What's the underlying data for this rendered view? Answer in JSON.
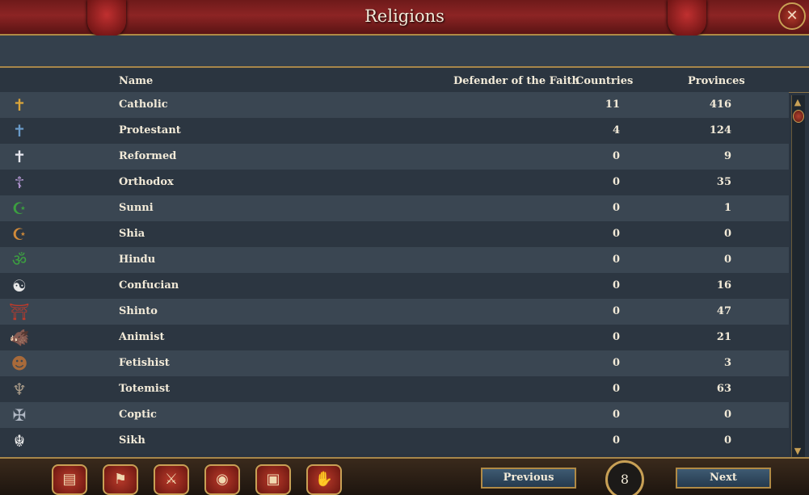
{
  "window": {
    "title": "Religions",
    "close_icon": "close-icon"
  },
  "columns": {
    "name": "Name",
    "defender": "Defender of the Faith",
    "countries": "Countries",
    "provinces": "Provinces"
  },
  "religions": [
    {
      "icon": "cross-icon",
      "glyph": "✝",
      "color": "#d9a53a",
      "name": "Catholic",
      "countries": "11",
      "provinces": "416"
    },
    {
      "icon": "cross-icon",
      "glyph": "✝",
      "color": "#6a9ac8",
      "name": "Protestant",
      "countries": "4",
      "provinces": "124"
    },
    {
      "icon": "cross-icon",
      "glyph": "✝",
      "color": "#e8e8f0",
      "name": "Reformed",
      "countries": "0",
      "provinces": "9"
    },
    {
      "icon": "orthodox-cross-icon",
      "glyph": "☦",
      "color": "#b89ad8",
      "name": "Orthodox",
      "countries": "0",
      "provinces": "35"
    },
    {
      "icon": "crescent-icon",
      "glyph": "☪",
      "color": "#3ca040",
      "name": "Sunni",
      "countries": "0",
      "provinces": "1"
    },
    {
      "icon": "crescent-icon",
      "glyph": "☪",
      "color": "#d08a3a",
      "name": "Shia",
      "countries": "0",
      "provinces": "0"
    },
    {
      "icon": "om-icon",
      "glyph": "ॐ",
      "color": "#3ca040",
      "name": "Hindu",
      "countries": "0",
      "provinces": "0"
    },
    {
      "icon": "yin-yang-icon",
      "glyph": "☯",
      "color": "#e8e8e8",
      "name": "Confucian",
      "countries": "0",
      "provinces": "16"
    },
    {
      "icon": "torii-gate-icon",
      "glyph": "⛩",
      "color": "#c03a2a",
      "name": "Shinto",
      "countries": "0",
      "provinces": "47"
    },
    {
      "icon": "animal-icon",
      "glyph": "🐗",
      "color": "#c04a2a",
      "name": "Animist",
      "countries": "0",
      "provinces": "21"
    },
    {
      "icon": "mask-icon",
      "glyph": "☻",
      "color": "#a86a3a",
      "name": "Fetishist",
      "countries": "0",
      "provinces": "3"
    },
    {
      "icon": "totem-icon",
      "glyph": "♆",
      "color": "#a89a88",
      "name": "Totemist",
      "countries": "0",
      "provinces": "63"
    },
    {
      "icon": "coptic-cross-icon",
      "glyph": "✠",
      "color": "#b0b8c4",
      "name": "Coptic",
      "countries": "0",
      "provinces": "0"
    },
    {
      "icon": "khanda-icon",
      "glyph": "☬",
      "color": "#e8e8e8",
      "name": "Sikh",
      "countries": "0",
      "provinces": "0"
    }
  ],
  "bottom_buttons": [
    {
      "icon": "scroll-icon",
      "glyph": "▤"
    },
    {
      "icon": "flag-icon",
      "glyph": "⚑"
    },
    {
      "icon": "crossed-swords-icon",
      "glyph": "⚔"
    },
    {
      "icon": "coins-icon",
      "glyph": "◉"
    },
    {
      "icon": "crate-icon",
      "glyph": "▣"
    },
    {
      "icon": "handshake-icon",
      "glyph": "✋"
    }
  ],
  "pagination": {
    "previous": "Previous",
    "page": "8",
    "next": "Next"
  }
}
